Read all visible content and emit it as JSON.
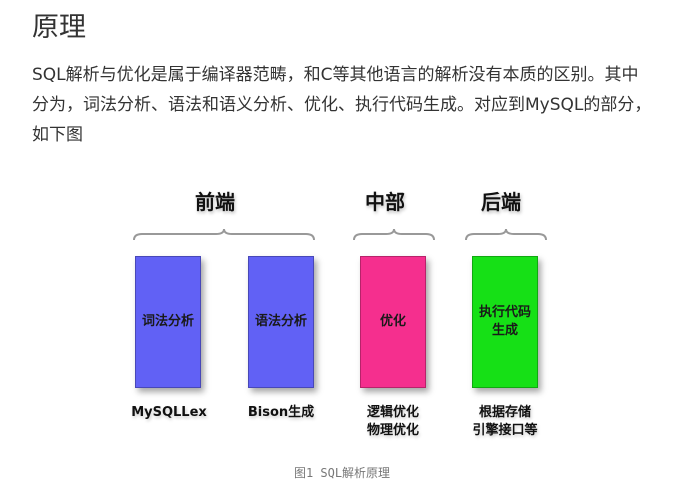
{
  "article": {
    "heading": "原理",
    "paragraph": "SQL解析与优化是属于编译器范畴，和C等其他语言的解析没有本质的区别。其中分为，词法分析、语法和语义分析、优化、执行代码生成。对应到MySQL的部分，如下图"
  },
  "figure": {
    "groups": {
      "frontend": "前端",
      "middle": "中部",
      "backend": "后端"
    },
    "blocks": [
      {
        "label": "词法分析",
        "color": "#6161f5"
      },
      {
        "label": "语法分析",
        "color": "#6161f5"
      },
      {
        "label": "优化",
        "color": "#f52f8e"
      },
      {
        "label": "执行代码\n生成",
        "color": "#16e016"
      }
    ],
    "captions": [
      "MySQLLex",
      "Bison生成",
      "逻辑优化\n物理优化",
      "根据存储\n引擎接口等"
    ],
    "caption": "图1  SQL解析原理"
  }
}
